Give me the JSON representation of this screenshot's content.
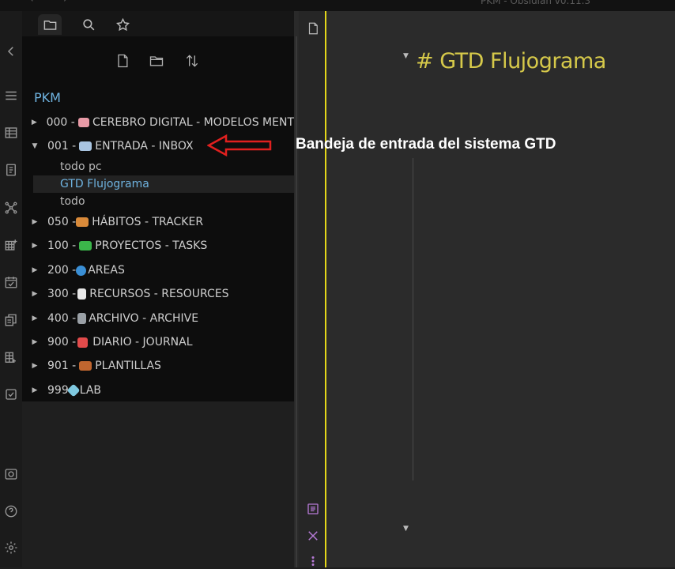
{
  "titlebar": {
    "title": "PKM - Obsidian v0.11.3",
    "back": "←",
    "forward": "→"
  },
  "ribbon": {
    "icons": [
      "collapse-icon",
      "menu-icon",
      "table-icon",
      "cards-icon",
      "graph-icon",
      "calendar-grid-icon",
      "calendar-check-icon",
      "copy-docs-icon",
      "kanban-icon",
      "checkbox-icon",
      "screen-capture-icon",
      "help-icon",
      "settings-icon"
    ],
    "collapse_glyph": "‹"
  },
  "sidebar": {
    "tabs": [
      "files-tab-icon",
      "search-tab-icon",
      "starred-tab-icon"
    ],
    "toolbar": [
      "new-note-icon",
      "new-folder-icon",
      "sort-icon"
    ],
    "vault_name": "PKM",
    "folders": [
      {
        "label": "000 - ",
        "emoji_color": "#e89aa6",
        "name": "CEREBRO DIGITAL - MODELOS MENT",
        "expanded": false
      },
      {
        "label": "001 - ",
        "emoji_color": "#a9c4e0",
        "name": "ENTRADA - INBOX",
        "expanded": true
      },
      {
        "label": "050 - ",
        "emoji_color": "#d98a3a",
        "name": "HÁBITOS - TRACKER",
        "expanded": false
      },
      {
        "label": "100 - ",
        "emoji_color": "#3bb54a",
        "name": "PROYECTOS - TASKS",
        "expanded": false
      },
      {
        "label": "200 - ",
        "emoji_color": "#3a8fd6",
        "name": "AREAS",
        "expanded": false
      },
      {
        "label": "300 - ",
        "emoji_color": "#e8e8e8",
        "name": "RECURSOS - RESOURCES",
        "expanded": false
      },
      {
        "label": "400 - ",
        "emoji_color": "#9aa0a6",
        "name": "ARCHIVO - ARCHIVE",
        "expanded": false
      },
      {
        "label": "900 - ",
        "emoji_color": "#e24b4b",
        "name": "DIARIO - JOURNAL",
        "expanded": false
      },
      {
        "label": "901 - ",
        "emoji_color": "#c0662f",
        "name": "PLANTILLAS",
        "expanded": false
      },
      {
        "label": "999 ",
        "emoji_color": "#7fc9e0",
        "name": "LAB",
        "expanded": false
      }
    ],
    "inbox_files": [
      {
        "name": "todo pc",
        "selected": false
      },
      {
        "name": "GTD Flujograma",
        "selected": true
      },
      {
        "name": "todo",
        "selected": false
      }
    ],
    "caret_collapsed": "▶",
    "caret_expanded": "▼"
  },
  "annotation": {
    "text": "Bandeja de entrada del sistema GTD",
    "arrow_color": "#e0201f"
  },
  "editor": {
    "title": "# GTD Flujograma",
    "fold_caret": "▼",
    "accent_color": "#e3d61a",
    "heading_color": "#d6c94a",
    "side_icons": [
      "file-icon",
      "outline-icon",
      "close-icon",
      "more-icon"
    ]
  }
}
